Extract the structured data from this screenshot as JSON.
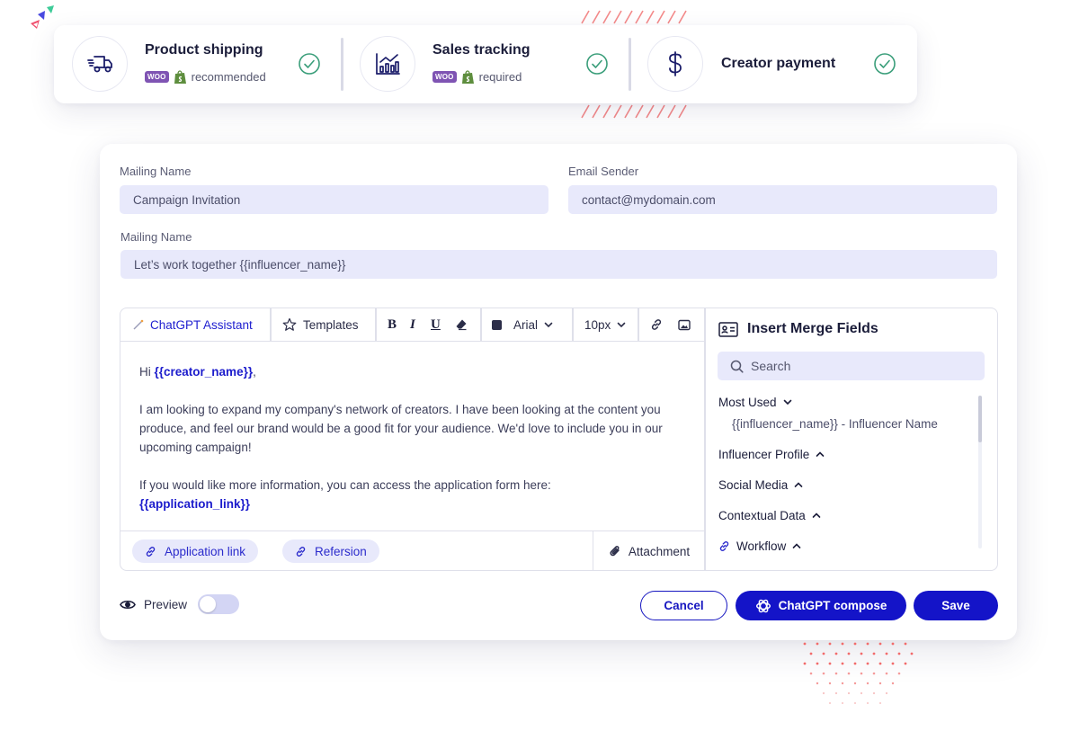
{
  "integrations": [
    {
      "title": "Product shipping",
      "badge": "WOO",
      "note": "recommended",
      "icon": "delivery-truck-icon"
    },
    {
      "title": "Sales tracking",
      "badge": "WOO",
      "note": "required",
      "icon": "bar-chart-icon"
    },
    {
      "title": "Creator payment",
      "icon": "dollar-icon"
    }
  ],
  "form": {
    "mailing_name_label": "Mailing Name",
    "mailing_name_value": "Campaign Invitation",
    "email_sender_label": "Email Sender",
    "email_sender_value": "contact@mydomain.com",
    "subject_label": "Mailing Name",
    "subject_value": "Let’s work together {{influencer_name}}"
  },
  "toolbar": {
    "gpt_assistant": "ChatGPT Assistant",
    "templates": "Templates",
    "bold": "B",
    "italic": "I",
    "underline": "U",
    "font": "Arial",
    "size": "10px"
  },
  "body": {
    "greeting": "Hi",
    "greeting_field": "{{creator_name}}",
    "greeting_end": ",",
    "paragraph1": "I am looking to expand my company's network of creators. I have been looking at the content you produce, and feel our brand would be a good fit for your audience. We'd love to include you in our upcoming campaign!",
    "paragraph2": "If you would like more information, you can access the application form here:",
    "paragraph2_field": "{{application_link}}"
  },
  "footer": {
    "chip1": "Application link",
    "chip2": "Refersion",
    "attachment": "Attachment"
  },
  "merge_panel": {
    "title": "Insert Merge Fields",
    "search_placeholder": "Search",
    "most_used": "Most Used",
    "most_used_item": "{{influencer_name}} - Influencer Name",
    "influencer_profile": "Influencer Profile",
    "social_media": "Social Media",
    "contextual_data": "Contextual Data",
    "workflow": "Workflow"
  },
  "actions": {
    "preview": "Preview",
    "cancel": "Cancel",
    "gpt_compose": "ChatGPT compose",
    "save": "Save"
  },
  "colors": {
    "primary": "#1414c8",
    "field_bg": "#e8e9fb",
    "check": "#3a9e7a",
    "woo": "#7f54b3",
    "shopify": "#5e8e3e"
  }
}
